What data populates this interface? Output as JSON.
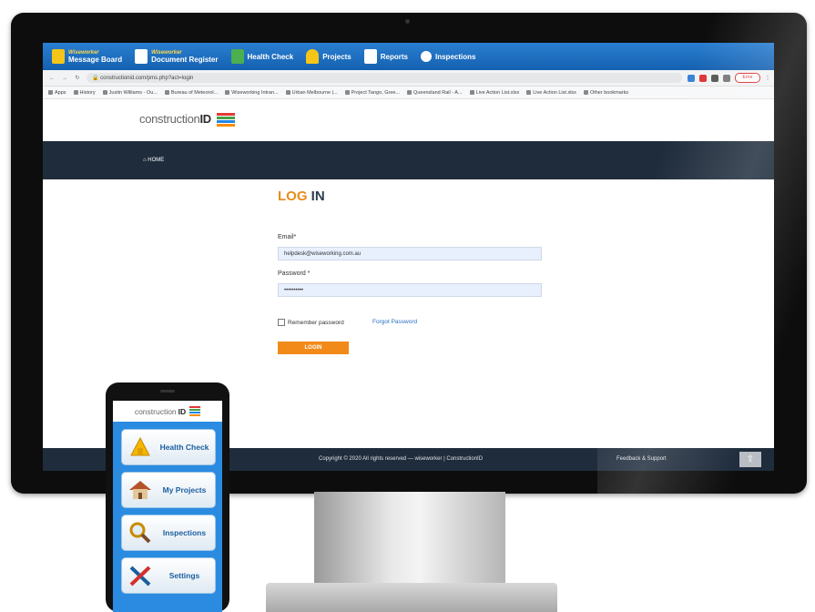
{
  "app_toolbar": {
    "items": [
      {
        "brand": "Wiseworker",
        "label": "Message Board",
        "icon": "message-board-icon",
        "color": "#f5c518"
      },
      {
        "brand": "Wiseworker",
        "label": "Document Register",
        "icon": "document-icon",
        "color": "#ffffff"
      },
      {
        "label": "Health Check",
        "icon": "plus-icon",
        "color": "#4caf50"
      },
      {
        "label": "Projects",
        "icon": "hardhat-icon",
        "color": "#f5c518"
      },
      {
        "label": "Reports",
        "icon": "reports-icon",
        "color": "#ffffff"
      },
      {
        "label": "Inspections",
        "icon": "magnifier-icon",
        "color": "#ffffff"
      }
    ]
  },
  "browser": {
    "url": "constructionid.com/pms.php?act=login",
    "error_label": "Error",
    "bookmarks": [
      "Apps",
      "History",
      "Justin Williams - Ou...",
      "Bureau of Meteorol...",
      "Wiseworking Intran...",
      "Urban Melbourne |...",
      "Project Tango, Gree...",
      "Queensland Rail - A...",
      "Live Action List.xlsx",
      "Live Action List.xlsx",
      "Other bookmarks"
    ]
  },
  "site": {
    "logo_light": "construction",
    "logo_bold": "ID",
    "home": "HOME",
    "login_title_orange": "LOG",
    "login_title_dark": " IN",
    "email_label": "Email*",
    "email_value": "helpdesk@wiseworking.com.au",
    "password_label": "Password *",
    "password_value": "••••••••••",
    "remember_label": "Remember password",
    "forgot_label": "Forgot Password",
    "login_button": "LOGIN",
    "footer_copyright": "Copyright © 2020 All rights reserved — wiseworker | ConstructionID",
    "footer_feedback": "Feedback & Support",
    "scroll_top": "⇧"
  },
  "phone": {
    "logo_light": "construction",
    "logo_bold": "ID",
    "buttons": [
      {
        "label": "Health Check",
        "icon": "health-check-icon"
      },
      {
        "label": "My Projects",
        "icon": "house-icon"
      },
      {
        "label": "Inspections",
        "icon": "magnifier-icon"
      },
      {
        "label": "Settings",
        "icon": "tools-icon"
      }
    ]
  },
  "colors": {
    "brand_orange": "#f28a1a",
    "nav_dark": "#1f2c3c",
    "toolbar_blue": "#1f6fc4",
    "phone_blue": "#2a8be0"
  }
}
